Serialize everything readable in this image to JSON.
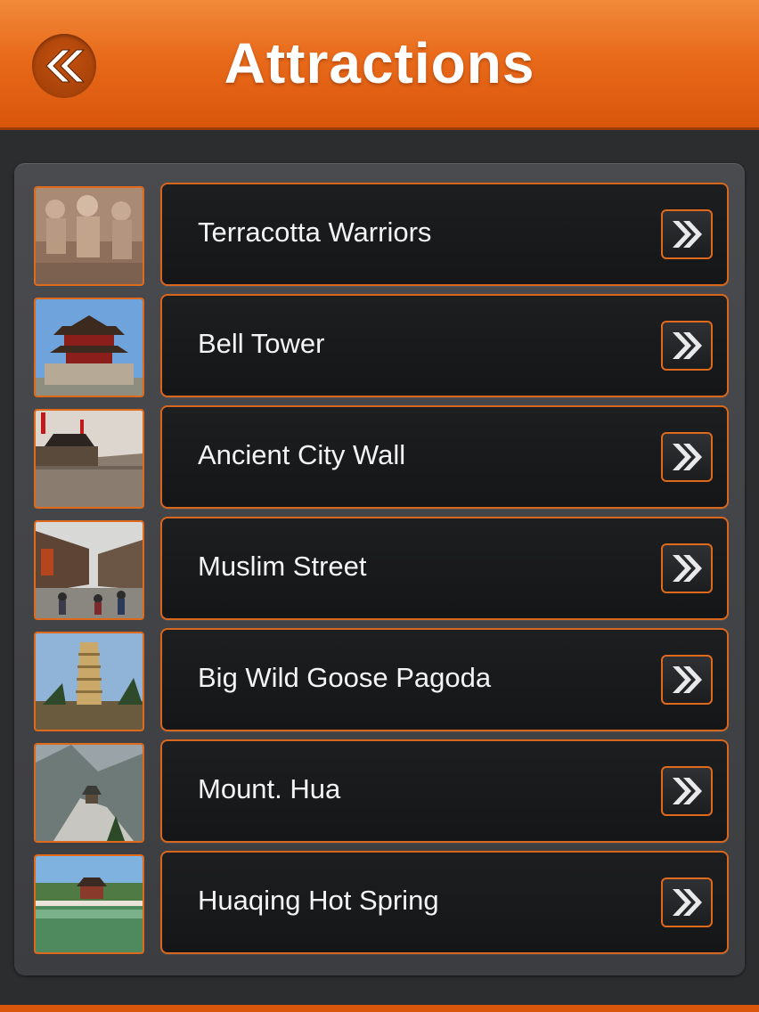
{
  "header": {
    "title": "Attractions",
    "back_icon": "double-chevron-left-icon",
    "color": "#e96a1b"
  },
  "list": {
    "accent_color": "#e06a1c",
    "arrow_icon": "double-chevron-right-icon",
    "items": [
      {
        "label": "Terracotta Warriors",
        "thumb": "terracotta-warriors-photo"
      },
      {
        "label": "Bell Tower",
        "thumb": "bell-tower-photo"
      },
      {
        "label": "Ancient City Wall",
        "thumb": "city-wall-photo"
      },
      {
        "label": "Muslim Street",
        "thumb": "muslim-street-photo"
      },
      {
        "label": "Big Wild Goose Pagoda",
        "thumb": "pagoda-photo"
      },
      {
        "label": "Mount. Hua",
        "thumb": "mount-hua-photo"
      },
      {
        "label": "Huaqing Hot Spring",
        "thumb": "hot-spring-photo"
      }
    ]
  }
}
